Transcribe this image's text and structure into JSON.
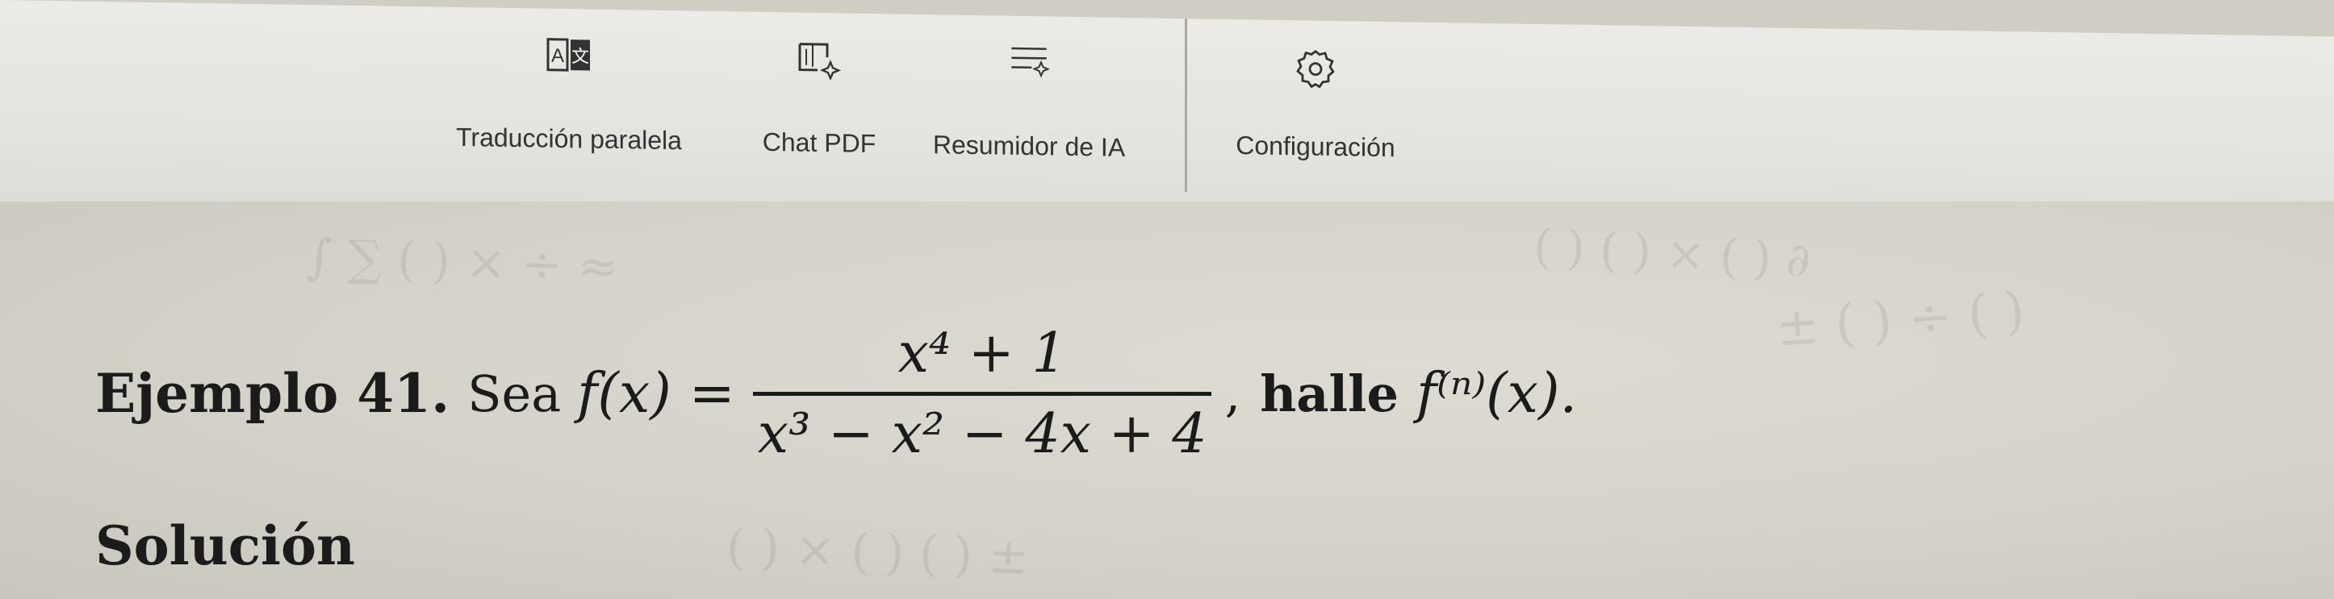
{
  "toolbar": {
    "items": [
      {
        "label": "Traducción paralela",
        "icon": "translate-icon"
      },
      {
        "label": "Chat PDF",
        "icon": "chat-pdf-icon"
      },
      {
        "label": "Resumidor de IA",
        "icon": "ai-summary-icon"
      },
      {
        "label": "Configuración",
        "icon": "gear-icon"
      }
    ]
  },
  "document": {
    "example_title": "Ejemplo 41.",
    "intro": "Sea",
    "function_lhs": "f(x)",
    "equals": "=",
    "numerator": "x⁴ + 1",
    "denominator": "x³ − x² − 4x + 4",
    "comma": ",",
    "halle": "halle",
    "target": "f⁽ⁿ⁾(x).",
    "solution_heading": "Solución"
  }
}
